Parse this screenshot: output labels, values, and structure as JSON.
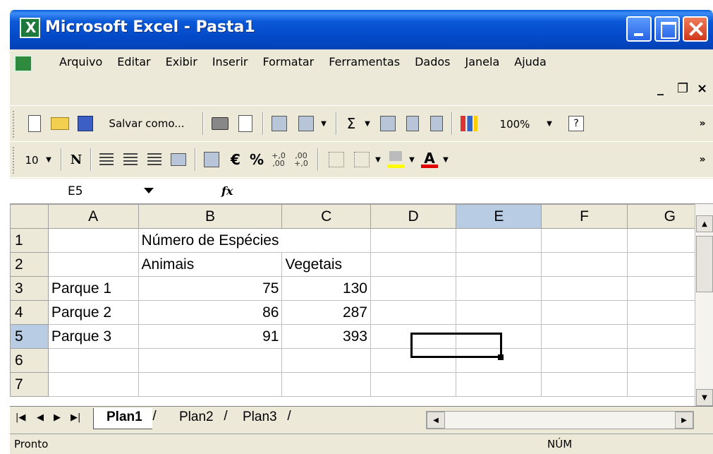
{
  "window": {
    "title": "Microsoft Excel - Pasta1",
    "icon": "excel-icon"
  },
  "menu": {
    "items": [
      "Arquivo",
      "Editar",
      "Exibir",
      "Inserir",
      "Formatar",
      "Ferramentas",
      "Dados",
      "Janela",
      "Ajuda"
    ],
    "mdi_min": "_",
    "mdi_restore": "❐",
    "mdi_close": "×"
  },
  "toolbar1": {
    "save_as_label": "Salvar como...",
    "sum_symbol": "Σ",
    "zoom": "100%",
    "more": "»"
  },
  "toolbar2": {
    "font_size": "10",
    "bold_label": "N",
    "currency_symbol": "€",
    "percent_symbol": "%",
    "more": "»"
  },
  "formula_bar": {
    "name_box": "E5",
    "fx_label": "fx",
    "formula": ""
  },
  "sheet": {
    "columns": [
      "A",
      "B",
      "C",
      "D",
      "E",
      "F",
      "G"
    ],
    "active_column": "E",
    "active_row": "5",
    "rows": [
      {
        "num": "1",
        "a": "",
        "b": "Número de Espécies",
        "c": "",
        "d": "",
        "e": "",
        "f": "",
        "g": ""
      },
      {
        "num": "2",
        "a": "",
        "b": "Animais",
        "c": "Vegetais",
        "d": "",
        "e": "",
        "f": "",
        "g": ""
      },
      {
        "num": "3",
        "a": "Parque 1",
        "b": "75",
        "c": "130",
        "d": "",
        "e": "",
        "f": "",
        "g": ""
      },
      {
        "num": "4",
        "a": "Parque 2",
        "b": "86",
        "c": "287",
        "d": "",
        "e": "",
        "f": "",
        "g": ""
      },
      {
        "num": "5",
        "a": "Parque 3",
        "b": "91",
        "c": "393",
        "d": "",
        "e": "",
        "f": "",
        "g": ""
      },
      {
        "num": "6",
        "a": "",
        "b": "",
        "c": "",
        "d": "",
        "e": "",
        "f": "",
        "g": ""
      },
      {
        "num": "7",
        "a": "",
        "b": "",
        "c": "",
        "d": "",
        "e": "",
        "f": "",
        "g": ""
      }
    ]
  },
  "tabs": {
    "items": [
      "Plan1",
      "Plan2",
      "Plan3"
    ],
    "active": "Plan1"
  },
  "status": {
    "left": "Pronto",
    "num_indicator": "NÚM"
  }
}
